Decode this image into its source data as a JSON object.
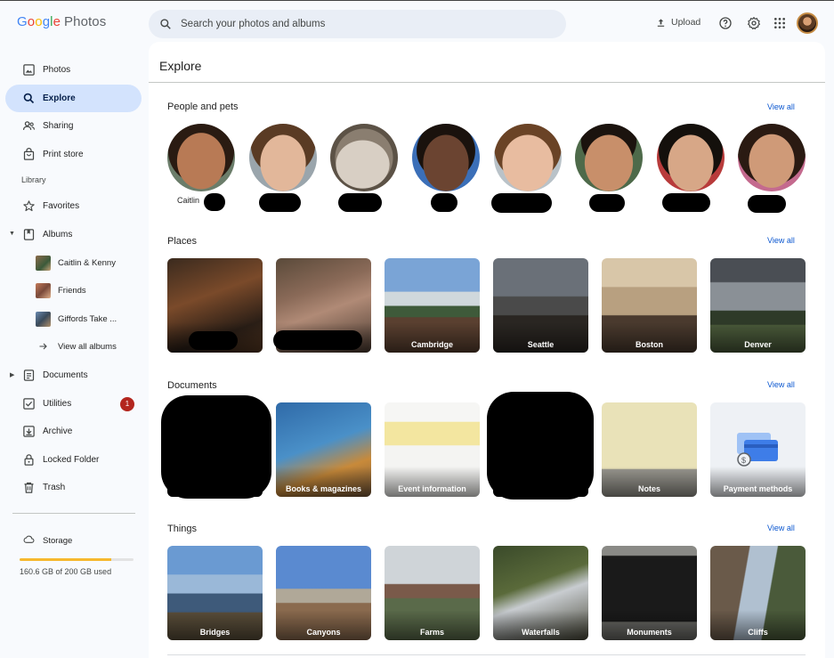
{
  "app": {
    "logo_letters": [
      "G",
      "o",
      "o",
      "g",
      "l",
      "e"
    ],
    "logo_suffix": "Photos"
  },
  "header": {
    "search_placeholder": "Search your photos and albums",
    "upload_label": "Upload",
    "icons": [
      "upload-icon",
      "help-icon",
      "settings-gear-icon",
      "apps-grid-icon",
      "account-avatar"
    ]
  },
  "sidebar": {
    "items": [
      {
        "label": "Photos",
        "icon": "photo-icon"
      },
      {
        "label": "Explore",
        "icon": "search-icon",
        "active": true
      },
      {
        "label": "Sharing",
        "icon": "people-icon"
      },
      {
        "label": "Print store",
        "icon": "shopping-bag-icon"
      }
    ],
    "library_label": "Library",
    "library_items": [
      {
        "label": "Favorites",
        "icon": "star-icon"
      },
      {
        "label": "Albums",
        "icon": "album-icon"
      }
    ],
    "albums": [
      {
        "label": "Caitlin & Kenny"
      },
      {
        "label": "Friends"
      },
      {
        "label": "Giffords Take ..."
      }
    ],
    "view_all_albums": "View all albums",
    "more_items": [
      {
        "label": "Documents",
        "icon": "document-icon"
      },
      {
        "label": "Utilities",
        "icon": "checkbox-icon",
        "badge": "1"
      },
      {
        "label": "Archive",
        "icon": "archive-icon"
      },
      {
        "label": "Locked Folder",
        "icon": "lock-icon"
      },
      {
        "label": "Trash",
        "icon": "trash-icon"
      }
    ],
    "storage": {
      "label": "Storage",
      "used_text": "160.6 GB of 200 GB used",
      "used_fraction": 0.803
    }
  },
  "main": {
    "title": "Explore",
    "view_all": "View all",
    "people": {
      "title": "People and pets",
      "names": [
        "Caitlin",
        "",
        "",
        "",
        "",
        "",
        "",
        ""
      ]
    },
    "places": {
      "title": "Places",
      "labels": [
        "",
        "",
        "Cambridge",
        "Seattle",
        "Boston",
        "Denver"
      ]
    },
    "documents": {
      "title": "Documents",
      "labels": [
        "",
        "Books & magazines",
        "Event information",
        "",
        "Notes",
        "Payment methods"
      ]
    },
    "things": {
      "title": "Things",
      "labels": [
        "Bridges",
        "Canyons",
        "Farms",
        "Waterfalls",
        "Monuments",
        "Cliffs"
      ]
    }
  },
  "colors": {
    "accent": "#0b57d0",
    "active_nav": "#d3e3fd",
    "badge": "#b3261e",
    "storage_fill": "#f6b82e"
  }
}
